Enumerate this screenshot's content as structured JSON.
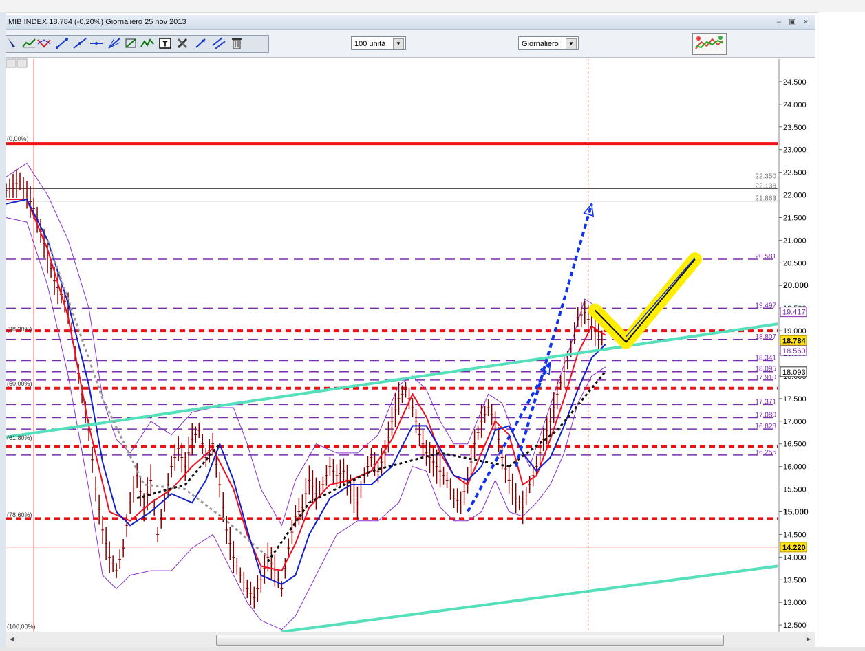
{
  "window": {
    "title": "MIB INDEX   18.784 (-0,20%)   Giornaliero  25 nov 2013",
    "buttons": "– ▣ ×"
  },
  "toolbar": {
    "units_select": "100 unità",
    "period_select": "Giornaliero"
  },
  "icons": [
    "cursor-icon",
    "trendline-icon",
    "channel-icon",
    "fibonacci-icon",
    "line-icon",
    "horizontal-line-icon",
    "fan-icon",
    "gann-icon",
    "zigzag-icon",
    "text-icon",
    "tools-icon",
    "arrow-icon",
    "parallel-icon",
    "delete-icon",
    "indicator-panel-icon"
  ],
  "colors": {
    "candle": "#8a0000",
    "sma_red": "#ee1122",
    "sma_blue": "#1122cc",
    "bollinger": "#8833cc",
    "support_red": "#ee1111",
    "trend_teal": "#55e0bb",
    "purple_level": "#7a2bb0",
    "highlight": "#ffee00",
    "projection_blue": "#1133ee"
  },
  "chart_data": {
    "type": "line",
    "title": "MIB INDEX",
    "ylim": [
      12350,
      25000
    ],
    "y_ticks": [
      "24.500",
      "24.000",
      "23.500",
      "23.000",
      "22.500",
      "22.000",
      "21.500",
      "21.000",
      "20.500",
      "20.000",
      "19.500",
      "19.000",
      "18.500",
      "18.000",
      "17.500",
      "17.000",
      "16.500",
      "16.000",
      "15.500",
      "15.000",
      "14.500",
      "14.000",
      "13.500",
      "13.000",
      "12.500"
    ],
    "bold_ticks": [
      "20.000",
      "15.000"
    ],
    "x_span": [
      0,
      112
    ],
    "last_close": 18784,
    "price_labels": [
      {
        "text": "19.417",
        "value": 19417,
        "style": "purple"
      },
      {
        "text": "18.784",
        "value": 18784,
        "style": "yellow"
      },
      {
        "text": "18.560",
        "value": 18560,
        "style": "purple"
      },
      {
        "text": "18.093",
        "value": 18093,
        "style": "plain"
      },
      {
        "text": "14.220",
        "value": 14220,
        "style": "yellow"
      }
    ],
    "fib_left_labels": [
      {
        "text": "(0,00%)",
        "value": 23250
      },
      {
        "text": "(38,20%)",
        "value": 19050
      },
      {
        "text": "(50,00%)",
        "value": 17850
      },
      {
        "text": "(61,80%)",
        "value": 16650
      },
      {
        "text": "(78,60%)",
        "value": 14950
      },
      {
        "text": "(100,00%)",
        "value": 12480
      }
    ],
    "gray_lines": [
      {
        "label": "22.350",
        "value": 22350
      },
      {
        "label": "22.138",
        "value": 22138
      },
      {
        "label": "21.863",
        "value": 21863
      }
    ],
    "purple_levels": [
      {
        "label": "20.581",
        "value": 20581
      },
      {
        "label": "19.497",
        "value": 19497
      },
      {
        "label": "18.807",
        "value": 18807
      },
      {
        "label": "18.341",
        "value": 18341
      },
      {
        "label": "18.095",
        "value": 18095
      },
      {
        "label": "17.910",
        "value": 17910
      },
      {
        "label": "17.371",
        "value": 17371
      },
      {
        "label": "17.080",
        "value": 17080
      },
      {
        "label": "16.828",
        "value": 16828
      },
      {
        "label": "16.255",
        "value": 16255
      }
    ],
    "red_levels": [
      23130,
      19000,
      17730,
      16440,
      14850
    ],
    "red_solid_level": 23130,
    "close_series": [
      [
        0,
        22100
      ],
      [
        2,
        22300
      ],
      [
        4,
        21700
      ],
      [
        5,
        21200
      ],
      [
        7,
        20100
      ],
      [
        9,
        19500
      ],
      [
        10,
        18500
      ],
      [
        11,
        17600
      ],
      [
        12,
        16800
      ],
      [
        13,
        15500
      ],
      [
        14,
        14600
      ],
      [
        15,
        14000
      ],
      [
        16,
        13700
      ],
      [
        17,
        14200
      ],
      [
        18,
        15200
      ],
      [
        19,
        15800
      ],
      [
        20,
        15100
      ],
      [
        21,
        15700
      ],
      [
        22,
        14500
      ],
      [
        23,
        15200
      ],
      [
        24,
        16000
      ],
      [
        25,
        16400
      ],
      [
        26,
        16000
      ],
      [
        27,
        16600
      ],
      [
        28,
        16800
      ],
      [
        29,
        16200
      ],
      [
        30,
        16500
      ],
      [
        31,
        15600
      ],
      [
        32,
        14600
      ],
      [
        33,
        14000
      ],
      [
        34,
        13600
      ],
      [
        35,
        13300
      ],
      [
        36,
        13100
      ],
      [
        37,
        13500
      ],
      [
        38,
        14000
      ],
      [
        39,
        13700
      ],
      [
        40,
        13300
      ],
      [
        41,
        14200
      ],
      [
        42,
        14900
      ],
      [
        43,
        15100
      ],
      [
        44,
        15700
      ],
      [
        45,
        15400
      ],
      [
        46,
        15600
      ],
      [
        47,
        16000
      ],
      [
        48,
        15800
      ],
      [
        49,
        15900
      ],
      [
        50,
        15500
      ],
      [
        51,
        15200
      ],
      [
        52,
        15800
      ],
      [
        53,
        16200
      ],
      [
        54,
        15900
      ],
      [
        55,
        16300
      ],
      [
        56,
        17000
      ],
      [
        57,
        17500
      ],
      [
        58,
        17700
      ],
      [
        59,
        17300
      ],
      [
        60,
        16700
      ],
      [
        61,
        16300
      ],
      [
        62,
        16100
      ],
      [
        63,
        15900
      ],
      [
        64,
        15700
      ],
      [
        65,
        15300
      ],
      [
        66,
        15200
      ],
      [
        67,
        15700
      ],
      [
        68,
        16500
      ],
      [
        69,
        17000
      ],
      [
        70,
        17300
      ],
      [
        71,
        17000
      ],
      [
        72,
        16200
      ],
      [
        73,
        15700
      ],
      [
        74,
        15300
      ],
      [
        75,
        15100
      ],
      [
        76,
        15600
      ],
      [
        77,
        16000
      ],
      [
        78,
        16600
      ],
      [
        79,
        17000
      ],
      [
        80,
        17600
      ],
      [
        81,
        18100
      ],
      [
        82,
        18600
      ],
      [
        83,
        19300
      ],
      [
        84,
        19400
      ],
      [
        85,
        19100
      ],
      [
        86,
        18900
      ],
      [
        87,
        18784
      ]
    ],
    "sma_red": [
      [
        0,
        21900
      ],
      [
        3,
        21900
      ],
      [
        6,
        20800
      ],
      [
        9,
        19300
      ],
      [
        12,
        16900
      ],
      [
        15,
        15000
      ],
      [
        18,
        14800
      ],
      [
        21,
        15200
      ],
      [
        24,
        15500
      ],
      [
        27,
        16000
      ],
      [
        30,
        16400
      ],
      [
        33,
        15500
      ],
      [
        35,
        14500
      ],
      [
        37,
        13800
      ],
      [
        40,
        13700
      ],
      [
        42,
        14300
      ],
      [
        44,
        15100
      ],
      [
        47,
        15600
      ],
      [
        50,
        15700
      ],
      [
        53,
        15900
      ],
      [
        56,
        16600
      ],
      [
        59,
        17600
      ],
      [
        61,
        17100
      ],
      [
        63,
        16300
      ],
      [
        65,
        15800
      ],
      [
        67,
        15600
      ],
      [
        69,
        16300
      ],
      [
        71,
        17000
      ],
      [
        73,
        16700
      ],
      [
        75,
        15600
      ],
      [
        77,
        15800
      ],
      [
        79,
        16600
      ],
      [
        81,
        17500
      ],
      [
        83,
        18500
      ],
      [
        85,
        19100
      ],
      [
        87,
        18900
      ]
    ],
    "sma_blue": [
      [
        0,
        21800
      ],
      [
        3,
        21900
      ],
      [
        6,
        21000
      ],
      [
        9,
        19600
      ],
      [
        12,
        17800
      ],
      [
        14,
        16100
      ],
      [
        16,
        15000
      ],
      [
        18,
        14700
      ],
      [
        21,
        15000
      ],
      [
        24,
        15400
      ],
      [
        27,
        15200
      ],
      [
        29,
        15700
      ],
      [
        31,
        16500
      ],
      [
        33,
        15700
      ],
      [
        35,
        14600
      ],
      [
        37,
        13600
      ],
      [
        40,
        13400
      ],
      [
        42,
        13600
      ],
      [
        44,
        14500
      ],
      [
        47,
        15300
      ],
      [
        50,
        15600
      ],
      [
        53,
        15600
      ],
      [
        56,
        16000
      ],
      [
        59,
        16900
      ],
      [
        61,
        16900
      ],
      [
        63,
        16400
      ],
      [
        65,
        15800
      ],
      [
        67,
        15700
      ],
      [
        69,
        16000
      ],
      [
        71,
        16800
      ],
      [
        73,
        16900
      ],
      [
        75,
        16300
      ],
      [
        77,
        15900
      ],
      [
        79,
        16200
      ],
      [
        81,
        16900
      ],
      [
        83,
        17700
      ],
      [
        85,
        18400
      ],
      [
        87,
        18700
      ]
    ],
    "bb_upper": [
      [
        0,
        22400
      ],
      [
        3,
        22700
      ],
      [
        6,
        22000
      ],
      [
        9,
        21000
      ],
      [
        12,
        19500
      ],
      [
        14,
        17500
      ],
      [
        16,
        16600
      ],
      [
        18,
        16300
      ],
      [
        21,
        17000
      ],
      [
        24,
        16700
      ],
      [
        27,
        17200
      ],
      [
        30,
        17300
      ],
      [
        33,
        17300
      ],
      [
        35,
        16500
      ],
      [
        37,
        15500
      ],
      [
        40,
        14700
      ],
      [
        42,
        15700
      ],
      [
        45,
        16500
      ],
      [
        48,
        16300
      ],
      [
        51,
        16300
      ],
      [
        54,
        16700
      ],
      [
        57,
        17800
      ],
      [
        59,
        18000
      ],
      [
        61,
        17700
      ],
      [
        63,
        17000
      ],
      [
        65,
        16500
      ],
      [
        67,
        16500
      ],
      [
        70,
        17600
      ],
      [
        72,
        17400
      ],
      [
        74,
        16600
      ],
      [
        76,
        16000
      ],
      [
        78,
        16900
      ],
      [
        80,
        17800
      ],
      [
        82,
        18700
      ],
      [
        84,
        19700
      ],
      [
        86,
        19500
      ],
      [
        87,
        19300
      ]
    ],
    "bb_lower": [
      [
        0,
        21500
      ],
      [
        3,
        21400
      ],
      [
        6,
        20000
      ],
      [
        9,
        18000
      ],
      [
        12,
        15500
      ],
      [
        14,
        13600
      ],
      [
        16,
        13300
      ],
      [
        18,
        13600
      ],
      [
        21,
        13700
      ],
      [
        24,
        13700
      ],
      [
        27,
        14200
      ],
      [
        30,
        14500
      ],
      [
        33,
        13600
      ],
      [
        35,
        13000
      ],
      [
        37,
        12600
      ],
      [
        40,
        12400
      ],
      [
        42,
        12700
      ],
      [
        45,
        13600
      ],
      [
        48,
        14500
      ],
      [
        51,
        14800
      ],
      [
        54,
        14800
      ],
      [
        57,
        15200
      ],
      [
        59,
        16000
      ],
      [
        61,
        15900
      ],
      [
        63,
        15100
      ],
      [
        65,
        14800
      ],
      [
        67,
        14800
      ],
      [
        69,
        15000
      ],
      [
        71,
        15700
      ],
      [
        73,
        15000
      ],
      [
        75,
        14900
      ],
      [
        77,
        15200
      ],
      [
        79,
        15600
      ],
      [
        81,
        16300
      ],
      [
        83,
        17400
      ],
      [
        85,
        18000
      ],
      [
        87,
        18200
      ]
    ],
    "trend_upper": [
      [
        0,
        16650
      ],
      [
        112,
        19150
      ]
    ],
    "trend_lower": [
      [
        40,
        12350
      ],
      [
        112,
        13800
      ]
    ],
    "gray_dotted_trend": [
      [
        6,
        21000
      ],
      [
        14,
        17500
      ],
      [
        20,
        15600
      ],
      [
        26,
        15500
      ],
      [
        32,
        14800
      ],
      [
        38,
        14000
      ]
    ],
    "black_dotted_trends": [
      [
        [
          19,
          15300
        ],
        [
          26,
          15600
        ],
        [
          31,
          16500
        ]
      ],
      [
        [
          38,
          13900
        ],
        [
          44,
          15200
        ],
        [
          53,
          15900
        ],
        [
          63,
          16300
        ],
        [
          73,
          16000
        ]
      ],
      [
        [
          73,
          16000
        ],
        [
          80,
          16800
        ],
        [
          87,
          18100
        ]
      ]
    ],
    "projection_arrows": [
      [
        [
          67,
          15000
        ],
        [
          79,
          18300
        ]
      ],
      [
        [
          74,
          16000
        ],
        [
          85,
          21800
        ]
      ]
    ],
    "checkmark": [
      [
        85.5,
        19450
      ],
      [
        90,
        18750
      ],
      [
        100,
        20580
      ]
    ],
    "vertical_marker_x": 84.5
  }
}
